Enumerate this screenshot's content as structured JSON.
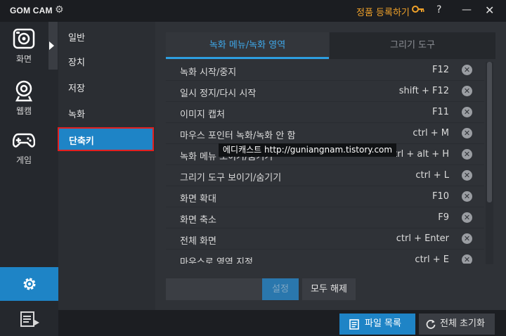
{
  "titlebar": {
    "app_name": "GOM CAM",
    "register_label": "정품 등록하기",
    "help_label": "?",
    "minimize_label": "—",
    "close_label": "✕"
  },
  "leftnav": {
    "items": [
      {
        "label": "화면",
        "icon": "screen-record-icon"
      },
      {
        "label": "웹캠",
        "icon": "webcam-icon"
      },
      {
        "label": "게임",
        "icon": "gamepad-icon"
      }
    ],
    "settings_icon": "gear-icon",
    "list_icon": "record-list-icon"
  },
  "submenu": {
    "items": [
      "일반",
      "장치",
      "저장",
      "녹화"
    ],
    "active": "단축키"
  },
  "tabs": {
    "tab1": "녹화 메뉴/녹화 영역",
    "tab2": "그리기 도구"
  },
  "shortcuts": [
    {
      "name": "녹화 시작/중지",
      "key": "F12"
    },
    {
      "name": "일시 정지/다시 시작",
      "key": "shift + F12"
    },
    {
      "name": "이미지 캡처",
      "key": "F11"
    },
    {
      "name": "마우스 포인터 녹화/녹화 안 함",
      "key": "ctrl + M"
    },
    {
      "name": "녹화 메뉴 보이기/숨기기",
      "key": "ctrl + alt + H"
    },
    {
      "name": "그리기 도구 보이기/숨기기",
      "key": "ctrl + L"
    },
    {
      "name": "화면 확대",
      "key": "F10"
    },
    {
      "name": "화면 축소",
      "key": "F9"
    },
    {
      "name": "전체 화면",
      "key": "ctrl + Enter"
    },
    {
      "name": "마우스로 영역 지정",
      "key": "ctrl + E"
    }
  ],
  "tooltip": "에디캐스트 http://guniangnam.tistory.com",
  "controls": {
    "set_label": "설정",
    "clear_all_label": "모두 해제"
  },
  "bottom": {
    "file_list_label": "파일 목록",
    "reset_all_label": "전체 초기화"
  },
  "colors": {
    "accent": "#1e84c6",
    "register": "#f0a22a",
    "active_tab_text": "#3fa7e8",
    "highlight_border": "#e22020"
  }
}
